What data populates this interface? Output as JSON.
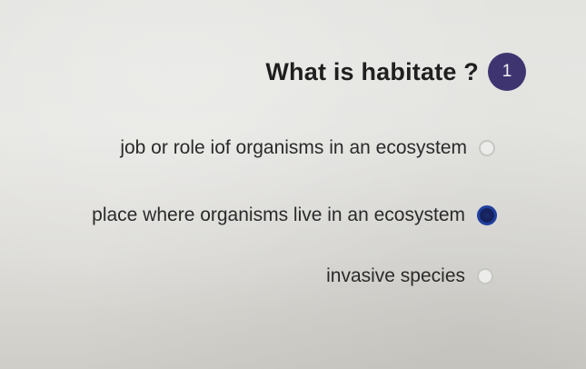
{
  "question": {
    "text": "What is habitate ?",
    "number": "1"
  },
  "options": [
    {
      "label": "job or role iof organisms in an ecosystem",
      "selected": false
    },
    {
      "label": "place where organisms live in an ecosystem",
      "selected": true
    },
    {
      "label": "invasive species",
      "selected": false
    }
  ],
  "colors": {
    "badge": "#3e3570",
    "selected_radio": "#1f3f9e"
  }
}
